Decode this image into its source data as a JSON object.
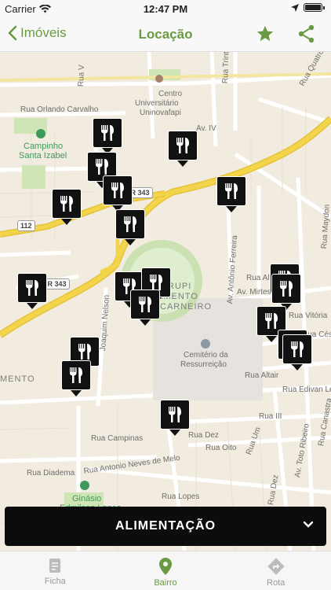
{
  "status_bar": {
    "carrier": "Carrier",
    "time": "12:47 PM"
  },
  "nav": {
    "back_label": "Imóveis",
    "title": "Locação",
    "icons": {
      "back": "chevron-left-icon",
      "favorite": "star-icon",
      "share": "share-icon"
    }
  },
  "map": {
    "labels": {
      "centro_universitario": "Centro",
      "centro_universitario_2": "Universitário",
      "uninovafapi": "Uninovafapi",
      "rua_orlando_carvalho": "Rua Orlando Carvalho",
      "campinho": "Campinho",
      "santa_izabel": "Santa Izabel",
      "av_iv": "Av. IV",
      "rua_trinta": "Rua Trinta",
      "rua_quatro": "Rua Quatro",
      "rua_v": "Rua V",
      "av_antonio_ferreira": "Av. Antônio Ferreira",
      "rua_alto_do": "Rua Alto do",
      "av_mirtes": "Av. Mirtes Me",
      "rua_vitoria": "Rua Vitória",
      "rua_cesar": "Rua Césa",
      "rua_maydon": "Rua Maydon",
      "joaquim_nelson": "Joaquim Nelson",
      "mento": "MENTO",
      "amento_paulo": "AMENTO",
      "carneiro": "CARNEIRO",
      "urupi": "RUPI",
      "cemiterio": "Cemitério da",
      "ressurreicao": "Ressurreição",
      "rua_altair": "Rua Altair",
      "rua_edivan": "Rua Edivan Lei",
      "rua_iii": "Rua III",
      "rua_dez": "Rua Dez",
      "rua_oito": "Rua Oito",
      "rua_um": "Rua Um",
      "rua_campinas": "Rua Campinas",
      "rua_diadema": "Rua Diadema",
      "antonio_neves": "Rua Antonio Neves de Melo",
      "rua_lopes": "Rua Lopes",
      "ginasio": "Ginásio",
      "ginasio_2": "Edmilson Lopes",
      "av_toto_ribeiro": "Av. Toto Ribeiro",
      "rua_canastra": "Rua Canastra",
      "rua_dezes": "Rua Dez"
    },
    "shields": {
      "br_343_a": "BR 343",
      "road_112": "112",
      "br_343_b": "BR 343"
    },
    "pin_icon": "fork-knife-icon",
    "colors": {
      "land": "#f1ecdf",
      "highway": "#f3d54c",
      "park": "#cfe5b5",
      "pin": "#111111"
    }
  },
  "category": {
    "label": "ALIMENTAÇÃO",
    "icon": "chevron-down-icon"
  },
  "tabs": [
    {
      "label": "Ficha",
      "icon": "document-icon",
      "active": false
    },
    {
      "label": "Bairro",
      "icon": "location-pin-icon",
      "active": true
    },
    {
      "label": "Rota",
      "icon": "directions-icon",
      "active": false
    }
  ],
  "accent_color": "#6a9a43"
}
